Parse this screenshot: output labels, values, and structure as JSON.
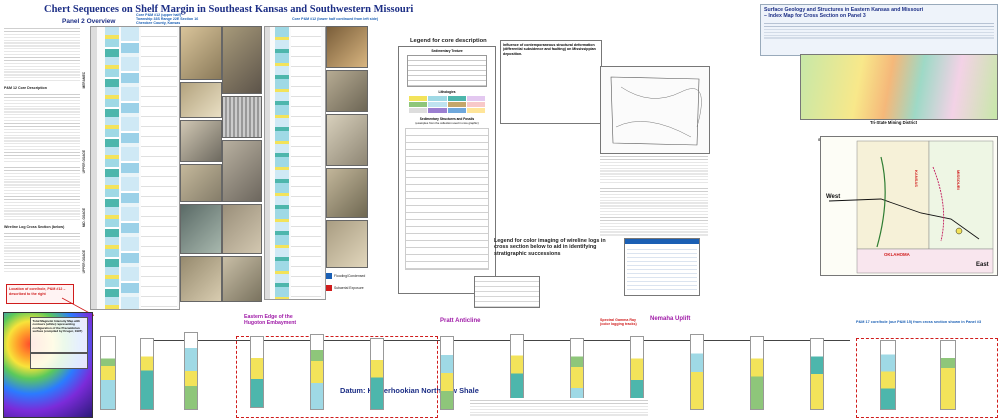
{
  "poster": {
    "title": "Chert Sequences on Shelf Margin in Southeast Kansas and Southwestern Missouri",
    "panel_title": "Panel 2 Overview"
  },
  "left_column": {
    "heading_core": "P&M 12 Core Description",
    "heading_wireline": "Wireline Log Cross Section  (below)",
    "location_note": "Location of core/hole, P&M #12 – described to the right"
  },
  "core_headers": {
    "core_a_line1": "Core P&M #12 (upper half)",
    "core_a_line2": "Township 33S Range 22E Section 16",
    "core_a_line3": "Cherokee County, Kansas",
    "core_b_line1": "Core P&M #12 (lower half continued from left side)"
  },
  "log_labels": {
    "meramec": "MERAMEC",
    "osage": "UPPER OSAGE",
    "mid_osage": "MID. OSAGE",
    "upper_osage": "UPPER OSAGE"
  },
  "flood_legend": {
    "flooding": "Flooding/Condensed",
    "exposure": "Subaerial Exposure"
  },
  "core_legend": {
    "title": "Legend for core description",
    "sedimentary": "Sedimentary Texture",
    "lithologies": "Lithologies",
    "structures": "Sedimentary Structures and Fossils",
    "structures_sub": "(examples from the collection used in core graphic)"
  },
  "influence": {
    "heading": "Influence of contemporaneous structural deformation (differential subsidence and faulting) on Mississippian deposition."
  },
  "index_map": {
    "title_line1": "Surface Geology and Structures in Eastern Kansas and Missouri",
    "title_line2": "– Index Map for Cross Section on Panel 3",
    "structures_title": "Structural Elements with index for Cross Section",
    "structures_note": "(shown in next panel)",
    "district": "Tri-State Mining District",
    "west": "West",
    "east": "East",
    "kansas": "KANSAS",
    "missouri": "MISSOURI",
    "oklahoma": "OKLAHOMA"
  },
  "wireline_legend": {
    "title": "Legend for color imaging of wireline logs in cross section below to aid in identifying stratigraphic successions"
  },
  "cross_section": {
    "hugoton": "Eastern Edge of the Hugoton Embayment",
    "pratt": "Pratt Anticline",
    "nemaha": "Nemaha Uplift",
    "datum": "Datum: Kinderhookian Northview Shale",
    "gamma_note": "Spectral Gamma Ray (color logging tracks)",
    "pm17": "P&M 17 core/hole (our P&M 15) from cross section shown in Panel #3",
    "magnetic": "Total Magnetic Intensity Map with contours (white) representing configuration of the Precambrian surface (compiled by Kruger, 1997)"
  },
  "colors": {
    "navy": "#1d2f86",
    "teal": "#4db6ac",
    "yellow": "#f3e35a",
    "red": "#d01c1c",
    "purple": "#a01ca8",
    "green": "#8ec67a"
  }
}
